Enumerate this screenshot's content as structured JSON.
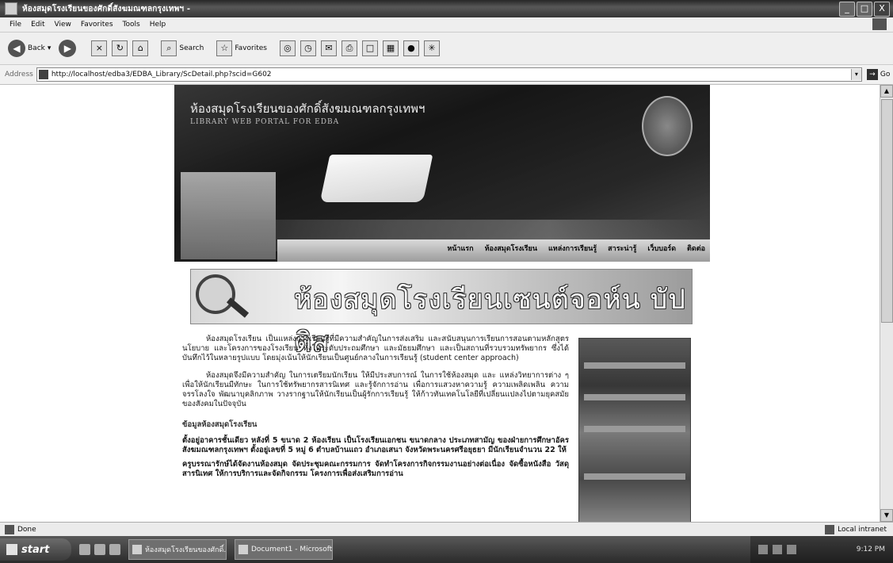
{
  "window": {
    "title": "ห้องสมุดโรงเรียนของศักดิ์สังฆมณฑลกรุงเทพฯ -",
    "controls": [
      "_",
      "□",
      "X"
    ]
  },
  "menu": [
    "File",
    "Edit",
    "View",
    "Favorites",
    "Tools",
    "Help"
  ],
  "toolbar": {
    "back_label": "Back",
    "search_label": "Search",
    "favorites_label": "Favorites"
  },
  "address": {
    "label": "Address",
    "url": "http://localhost/edba3/EDBA_Library/ScDetail.php?scid=G602",
    "go_label": "Go"
  },
  "banner": {
    "title": "ห้องสมุดโรงเรียนของศักดิ์สังฆมณฑลกรุงเทพฯ",
    "subtitle": "LIBRARY WEB PORTAL FOR EDBA",
    "nav": [
      "หน้าแรก",
      "ห้องสมุดโรงเรียน",
      "แหล่งการเรียนรู้",
      "สาระน่ารู้",
      "เว็บบอร์ด",
      "ติดต่อ"
    ]
  },
  "header": {
    "school_name": "ห้องสมุดโรงเรียนเซนต์จอห์น บัปติส"
  },
  "content": {
    "para1": "ห้องสมุดโรงเรียน เป็นแหล่งการเรียนรู้ที่มีความสำคัญในการส่งเสริม และสนับสนุนการเรียนการสอนตามหลักสูตร นโยบาย และโครงการของโรงเรียน ทั้งในระดับประถมศึกษา และมัธยมศึกษา และเป็นสถานที่รวบรวมทรัพยากร ซึ่งได้บันทึกไว้ในหลายรูปแบบ โดยมุ่งเน้นให้นักเรียนเป็นศูนย์กลางในการเรียนรู้ (student center approach)",
    "para2": "ห้องสมุดจึงมีความสำคัญ ในการเตรียมนักเรียน ให้มีประสบการณ์ ในการใช้ห้องสมุด และ แหล่งวิทยาการต่าง ๆ เพื่อให้นักเรียนมีทักษะ ในการใช้ทรัพยากรสารนิเทศ และรู้จักการอ่าน เพื่อการแสวงหาความรู้ ความเพลิดเพลิน ความจรรโลงใจ พัฒนาบุคลิกภาพ วางรากฐานให้นักเรียนเป็นผู้รักการเรียนรู้ ให้ก้าวทันเทคโนโลยีที่เปลี่ยนแปลงไปตามยุคสมัยของสังคมในปัจจุบัน",
    "section_title": "ข้อมูลห้องสมุดโรงเรียน",
    "info1": "ตั้งอยู่อาคารชั้นเดียว หลังที่ 5 ขนาด 2 ห้องเรียน เป็นโรงเรียนเอกชน ขนาดกลาง ประเภทสามัญ ของฝ่ายการศึกษาอัครสังฆมณฑลกรุงเทพฯ ตั้งอยู่เลขที่ 5 หมู่ 6 ตำบลบ้านแถว อำเภอเสนา จังหวัดพระนครศรีอยุธยา มีนักเรียนจำนวน 22 ให้",
    "info2": "ครูบรรณารักษ์ได้จัดงานห้องสมุด จัดประชุมคณะกรรมการ จัดทำโครงการกิจกรรมงานอย่างต่อเนื่อง จัดซื้อหนังสือ วัสดุ สารนิเทศ ให้การบริการและจัดกิจกรรม โครงการเพื่อส่งเสริมการอ่าน"
  },
  "status": {
    "text": "Done",
    "zone": "Local intranet"
  },
  "taskbar": {
    "start_label": "start",
    "tasks": [
      "ห้องสมุดโรงเรียนของศักดิ์...",
      "Document1 - Microsoft ..."
    ],
    "clock": "9:12 PM"
  }
}
